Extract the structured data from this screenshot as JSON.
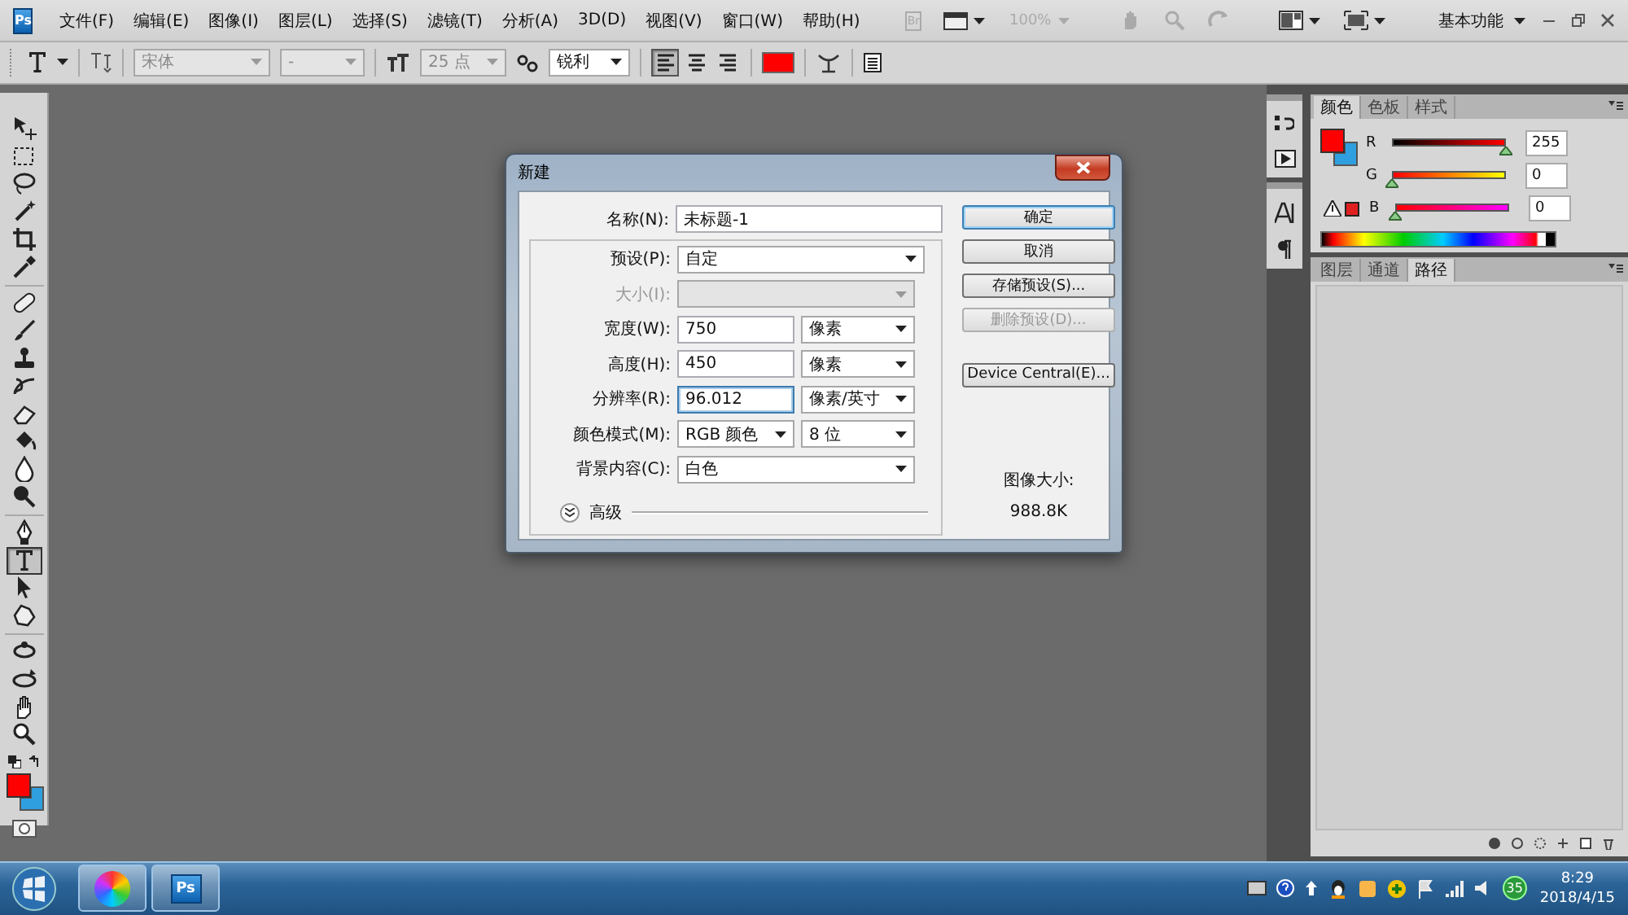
{
  "menubar": {
    "app_icon": "Ps",
    "menus": [
      "文件(F)",
      "编辑(E)",
      "图像(I)",
      "图层(L)",
      "选择(S)",
      "滤镜(T)",
      "分析(A)",
      "3D(D)",
      "视图(V)",
      "窗口(W)",
      "帮助(H)"
    ],
    "bridge": "Br",
    "zoom": {
      "value": "100%",
      "disabled": true
    },
    "workspace": "基本功能"
  },
  "options_bar": {
    "font_family": {
      "value": "宋体",
      "disabled": true
    },
    "font_style": {
      "value": "-",
      "disabled": true
    },
    "font_size": {
      "value": "25 点",
      "disabled": true
    },
    "anti_alias": {
      "value": "锐利",
      "disabled": false
    },
    "align": [
      {
        "selected": true
      },
      {
        "selected": false
      },
      {
        "selected": false
      }
    ],
    "text_color": {
      "color": "#ff0000"
    }
  },
  "toolbox": {
    "tools": [
      {
        "kind": "move",
        "selected": false
      },
      {
        "kind": "marquee",
        "selected": false
      },
      {
        "kind": "lasso",
        "selected": false
      },
      {
        "kind": "wand",
        "selected": false
      },
      {
        "kind": "crop",
        "selected": false
      },
      {
        "kind": "eyedropper",
        "selected": false
      },
      {
        "kind": "bandage",
        "selected": false
      },
      {
        "kind": "brush",
        "selected": false
      },
      {
        "kind": "stamp",
        "selected": false
      },
      {
        "kind": "history",
        "selected": false
      },
      {
        "kind": "eraser",
        "selected": false
      },
      {
        "kind": "bucket",
        "selected": false
      },
      {
        "kind": "drop",
        "selected": false
      },
      {
        "kind": "dodge",
        "selected": false
      },
      {
        "kind": "pen",
        "selected": false
      },
      {
        "kind": "type",
        "selected": true
      },
      {
        "kind": "pointer",
        "selected": false
      },
      {
        "kind": "shape",
        "selected": false
      },
      {
        "kind": "rotate",
        "selected": false
      },
      {
        "kind": "orbit",
        "selected": false
      },
      {
        "kind": "hand",
        "selected": false
      },
      {
        "kind": "zoom",
        "selected": false
      }
    ],
    "foreground": {
      "color": "#ff0000"
    },
    "background": {
      "color": "#2f9fe0"
    }
  },
  "dialog": {
    "title": "新建",
    "name": {
      "label": "名称(N):",
      "value": "未标题-1"
    },
    "preset": {
      "label": "预设(P):",
      "value": "自定"
    },
    "rows": [
      {
        "kind": "select",
        "label": "大小(I):",
        "disabled": true
      },
      {
        "kind": "input_unit",
        "label": "宽度(W):",
        "value": "750",
        "unit": "像素",
        "focused": false
      },
      {
        "kind": "input_unit",
        "label": "高度(H):",
        "value": "450",
        "unit": "像素",
        "focused": false
      },
      {
        "kind": "input_unit",
        "label": "分辨率(R):",
        "value": "96.012",
        "unit": "像素/英寸",
        "focused": true
      },
      {
        "kind": "select_pair",
        "label": "颜色模式(M):",
        "value": "RGB 颜色",
        "unit": "8 位"
      },
      {
        "kind": "select",
        "label": "背景内容(C):",
        "value": "白色",
        "disabled": false
      }
    ],
    "advanced": {
      "label": "高级",
      "expanded": false
    },
    "buttons": [
      {
        "label": "确定",
        "default": true,
        "disabled": false
      },
      {
        "label": "取消",
        "default": false,
        "disabled": false
      },
      {
        "label": "存储预设(S)...",
        "default": false,
        "disabled": false
      },
      {
        "label": "删除预设(D)...",
        "default": false,
        "disabled": true
      },
      {
        "label": "Device Central(E)...",
        "default": false,
        "disabled": false
      }
    ],
    "image_size": {
      "label": "图像大小:",
      "value": "988.8K"
    }
  },
  "color_panel": {
    "tabs": [
      {
        "label": "颜色",
        "selected": true
      },
      {
        "label": "色板",
        "selected": false
      },
      {
        "label": "样式",
        "selected": false
      }
    ],
    "foreground": {
      "color": "#ff0000"
    },
    "background": {
      "color": "#2f9fe0"
    },
    "channels": [
      {
        "name": "R",
        "level": 1,
        "value": "255"
      },
      {
        "name": "G",
        "level": 0,
        "value": "0"
      },
      {
        "name": "B",
        "level": 0,
        "value": "0"
      }
    ]
  },
  "layers_panel": {
    "tabs": [
      {
        "label": "图层",
        "selected": false
      },
      {
        "label": "通道",
        "selected": false
      },
      {
        "label": "路径",
        "selected": true
      }
    ]
  },
  "taskbar": {
    "apps": [
      {
        "kind": "color_wheel"
      },
      {
        "kind": "photoshop",
        "label": "Ps"
      }
    ],
    "tray_badge": "35",
    "time": "8:29",
    "date": "2018/4/15"
  }
}
